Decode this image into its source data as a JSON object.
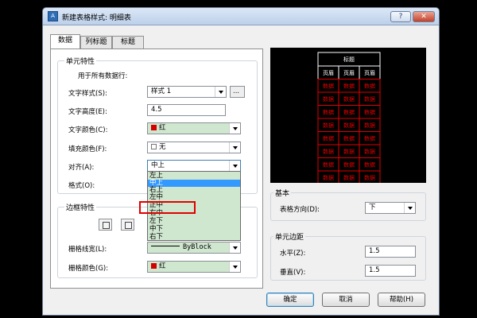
{
  "window": {
    "title": "新建表格样式: 明细表",
    "help_label": "?",
    "close_label": "✕"
  },
  "tabs": [
    "数据",
    "列标题",
    "标题"
  ],
  "cell_properties": {
    "group_title": "单元特性",
    "subtitle": "用于所有数据行:",
    "text_style_label": "文字样式(S):",
    "text_style_value": "样式 1",
    "browse_label": "...",
    "text_height_label": "文字高度(E):",
    "text_height_value": "4.5",
    "text_color_label": "文字颜色(C):",
    "text_color_value": "红",
    "fill_color_label": "填充颜色(F):",
    "fill_color_value": "无",
    "align_label": "对齐(A):",
    "align_value": "中上",
    "format_label": "格式(O):"
  },
  "align_options": [
    "左上",
    "中上",
    "右上",
    "左中",
    "正中",
    "右中",
    "左下",
    "中下",
    "右下"
  ],
  "align_selected_index": 1,
  "border_properties": {
    "group_title": "边框特性",
    "lineweight_label": "栅格线宽(L):",
    "lineweight_value": "ByBlock",
    "color_label": "栅格颜色(G):",
    "color_value": "红"
  },
  "preview": {
    "header_text": "标题",
    "col_header": "页眉",
    "cell_text": "数据",
    "cols": 3,
    "data_rows": 9
  },
  "basic": {
    "group_title": "基本",
    "direction_label": "表格方向(D):",
    "direction_value": "下"
  },
  "cell_margins": {
    "group_title": "单元边距",
    "horizontal_label": "水平(Z):",
    "horizontal_value": "1.5",
    "vertical_label": "垂直(V):",
    "vertical_value": "1.5"
  },
  "buttons": {
    "ok": "确定",
    "cancel": "取消",
    "help": "帮助(H)"
  },
  "colors": {
    "accent_blue": "#3399ff",
    "preview_red": "#e00000",
    "combo_green": "#cfe6cf"
  }
}
